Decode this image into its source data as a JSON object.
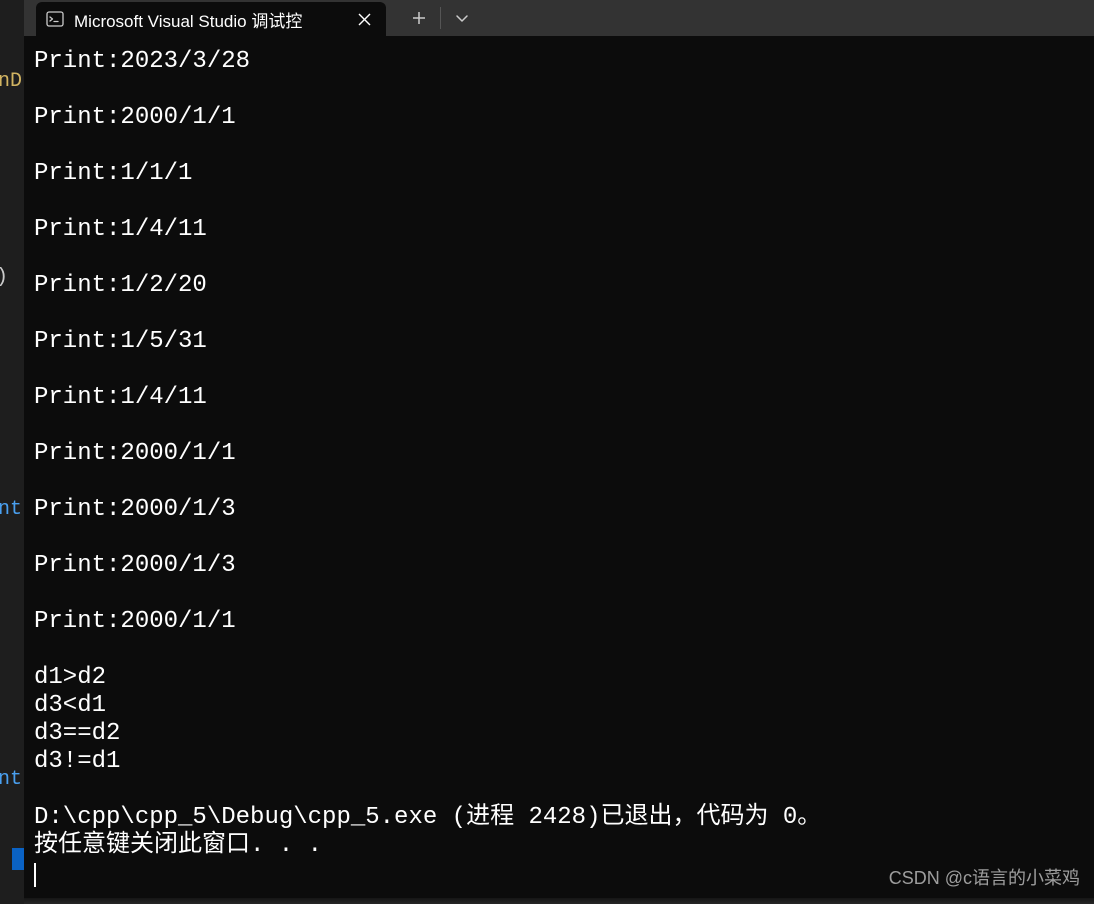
{
  "tab": {
    "title": "Microsoft Visual Studio 调试控"
  },
  "editor_fragments": {
    "f1": "nD",
    "f2": ")",
    "f3": "nt",
    "f4": "nt"
  },
  "output_lines": [
    "Print:2023/3/28",
    "",
    "Print:2000/1/1",
    "",
    "Print:1/1/1",
    "",
    "Print:1/4/11",
    "",
    "Print:1/2/20",
    "",
    "Print:1/5/31",
    "",
    "Print:1/4/11",
    "",
    "Print:2000/1/1",
    "",
    "Print:2000/1/3",
    "",
    "Print:2000/1/3",
    "",
    "Print:2000/1/1",
    "",
    "d1>d2",
    "d3<d1",
    "d3==d2",
    "d3!=d1",
    "",
    "D:\\cpp\\cpp_5\\Debug\\cpp_5.exe (进程 2428)已退出，代码为 0。",
    "按任意键关闭此窗口. . ."
  ],
  "watermark": "CSDN @c语言的小菜鸡"
}
